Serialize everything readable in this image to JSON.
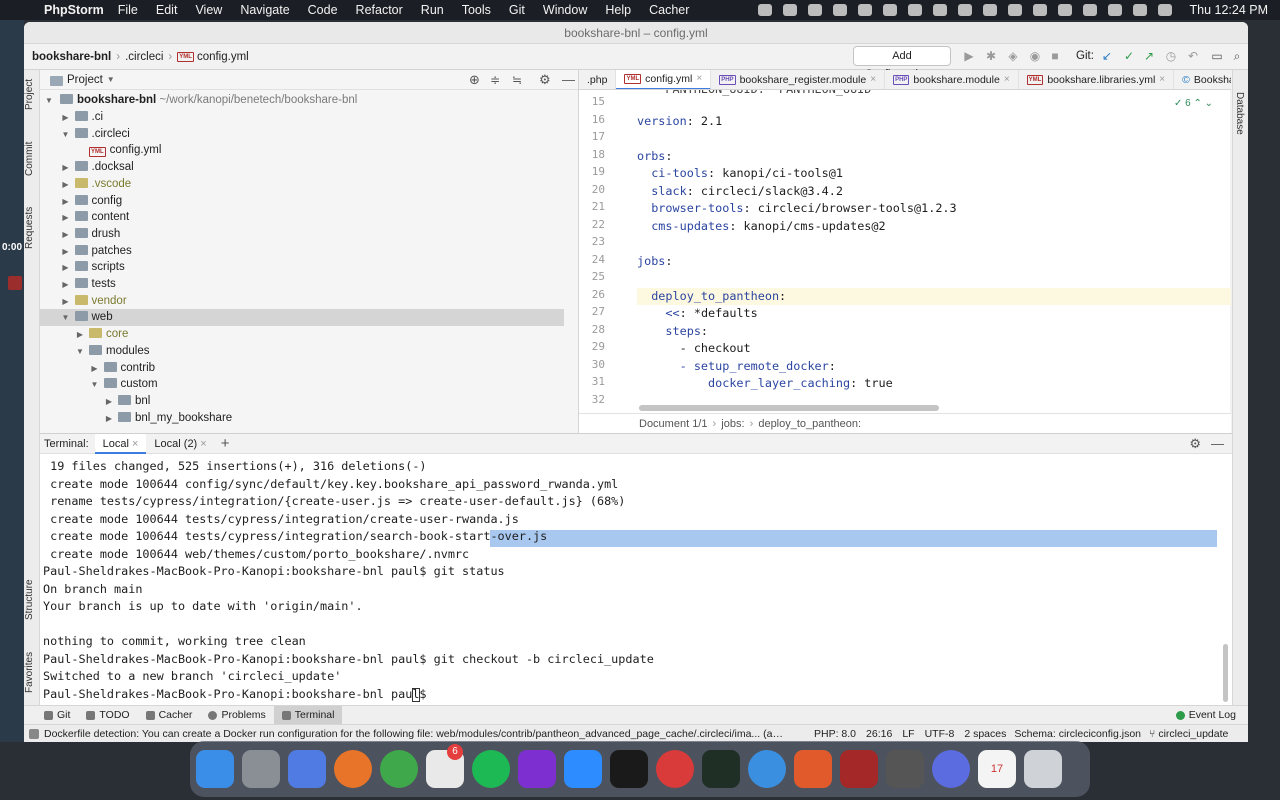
{
  "menubar": {
    "app": "PhpStorm",
    "items": [
      "File",
      "Edit",
      "View",
      "Navigate",
      "Code",
      "Refactor",
      "Run",
      "Tools",
      "Git",
      "Window",
      "Help",
      "Cacher"
    ],
    "clock": "Thu 12:24 PM"
  },
  "recorder": {
    "time": "0:00"
  },
  "window": {
    "title": "bookshare-bnl – config.yml",
    "breadcrumb": [
      "bookshare-bnl",
      ".circleci",
      "config.yml"
    ],
    "add_configuration": "Add Configuration...",
    "git_label": "Git:"
  },
  "left_strip": {
    "project": "Project",
    "commit": "Commit",
    "requests": "Requests",
    "structure": "Structure",
    "favorites": "Favorites"
  },
  "right_strip": {
    "database": "Database"
  },
  "project": {
    "header": "Project",
    "root": "bookshare-bnl",
    "root_path": "~/work/kanopi/benetech/bookshare-bnl",
    "tree": [
      {
        "label": ".ci",
        "depth": 1,
        "open": false
      },
      {
        "label": ".circleci",
        "depth": 1,
        "open": true
      },
      {
        "label": "config.yml",
        "depth": 2,
        "file": true
      },
      {
        "label": ".docksal",
        "depth": 1,
        "open": false
      },
      {
        "label": ".vscode",
        "depth": 1,
        "open": false,
        "olive": true
      },
      {
        "label": "config",
        "depth": 1,
        "open": false
      },
      {
        "label": "content",
        "depth": 1,
        "open": false
      },
      {
        "label": "drush",
        "depth": 1,
        "open": false
      },
      {
        "label": "patches",
        "depth": 1,
        "open": false
      },
      {
        "label": "scripts",
        "depth": 1,
        "open": false
      },
      {
        "label": "tests",
        "depth": 1,
        "open": false
      },
      {
        "label": "vendor",
        "depth": 1,
        "open": false,
        "olive": true
      },
      {
        "label": "web",
        "depth": 1,
        "open": true,
        "selected": true
      },
      {
        "label": "core",
        "depth": 2,
        "open": false,
        "olive": true
      },
      {
        "label": "modules",
        "depth": 2,
        "open": true
      },
      {
        "label": "contrib",
        "depth": 3,
        "open": false
      },
      {
        "label": "custom",
        "depth": 3,
        "open": true
      },
      {
        "label": "bnl",
        "depth": 4,
        "open": false
      },
      {
        "label": "bnl_my_bookshare",
        "depth": 4,
        "open": false
      }
    ]
  },
  "editor": {
    "tabs": [
      ".php",
      "config.yml",
      "bookshare_register.module",
      "bookshare.module",
      "bookshare.libraries.yml",
      "BookshareConfig"
    ],
    "inspection_count": "6",
    "breadcrumb": [
      "Document 1/1",
      "jobs:",
      "deploy_to_pantheon:"
    ],
    "line_numbers": [
      "15",
      "16",
      "17",
      "18",
      "19",
      "20",
      "21",
      "22",
      "23",
      "24",
      "25",
      "26",
      "27",
      "28",
      "29",
      "30",
      "31",
      "32"
    ],
    "top_partial": "    PANTHEON_UUID: *PANTHEON_UUID",
    "lines": [
      {
        "n": "15",
        "key": "",
        "val": ""
      },
      {
        "n": "16",
        "key": "version",
        "val": " 2.1"
      },
      {
        "n": "17",
        "key": "",
        "val": ""
      },
      {
        "n": "18",
        "key": "orbs",
        "val": ""
      },
      {
        "n": "19",
        "key": "  ci-tools",
        "val": " kanopi/ci-tools@1"
      },
      {
        "n": "20",
        "key": "  slack",
        "val": " circleci/slack@3.4.2"
      },
      {
        "n": "21",
        "key": "  browser-tools",
        "val": " circleci/browser-tools@1.2.3"
      },
      {
        "n": "22",
        "key": "  cms-updates",
        "val": " kanopi/cms-updates@2"
      },
      {
        "n": "23",
        "key": "",
        "val": ""
      },
      {
        "n": "24",
        "key": "jobs",
        "val": ""
      },
      {
        "n": "25",
        "key": "",
        "val": ""
      },
      {
        "n": "26",
        "key": "  deploy_to_pantheon",
        "val": ""
      },
      {
        "n": "27",
        "key": "    <<",
        "val": " *defaults"
      },
      {
        "n": "28",
        "key": "    steps",
        "val": ""
      },
      {
        "n": "29",
        "key": "",
        "val": "      - checkout"
      },
      {
        "n": "30",
        "key": "      - setup_remote_docker",
        "val": ""
      },
      {
        "n": "31",
        "key": "          docker_layer_caching",
        "val": " true"
      }
    ]
  },
  "terminal": {
    "label": "Terminal:",
    "tabs": [
      "Local",
      "Local (2)"
    ],
    "lines": [
      " 19 files changed, 525 insertions(+), 316 deletions(-)",
      " create mode 100644 config/sync/default/key.key.bookshare_api_password_rwanda.yml",
      " rename tests/cypress/integration/{create-user.js => create-user-default.js} (68%)",
      " create mode 100644 tests/cypress/integration/create-user-rwanda.js",
      " create mode 100644 tests/cypress/integration/search-book-start-over.js",
      " create mode 100644 web/themes/custom/porto_bookshare/.nvmrc",
      "Paul-Sheldrakes-MacBook-Pro-Kanopi:bookshare-bnl paul$ git status",
      "On branch main",
      "Your branch is up to date with 'origin/main'.",
      "",
      "nothing to commit, working tree clean",
      "Paul-Sheldrakes-MacBook-Pro-Kanopi:bookshare-bnl paul$ git checkout -b circleci_update",
      "Switched to a new branch 'circleci_update'",
      "Paul-Sheldrakes-MacBook-Pro-Kanopi:bookshare-bnl paul$ "
    ]
  },
  "bottom_tabs": [
    "Git",
    "TODO",
    "Cacher",
    "Problems",
    "Terminal"
  ],
  "event_log": "Event Log",
  "statusbar": {
    "message": "Dockerfile detection: You can create a Docker run configuration for the following file: web/modules/contrib/pantheon_advanced_page_cache/.circleci/ima... (a minute ago)",
    "php": "PHP: 8.0",
    "position": "26:16",
    "line_sep": "LF",
    "encoding": "UTF-8",
    "indent": "2 spaces",
    "schema": "Schema: circleciconfig.json",
    "branch": "circleci_update"
  },
  "dock": {
    "slack_badge": "6",
    "calendar_day": "17"
  },
  "colors": {
    "accent": "#3d7de0",
    "selection": "#a8c8f0",
    "yaml_key": "#2b45a0"
  }
}
